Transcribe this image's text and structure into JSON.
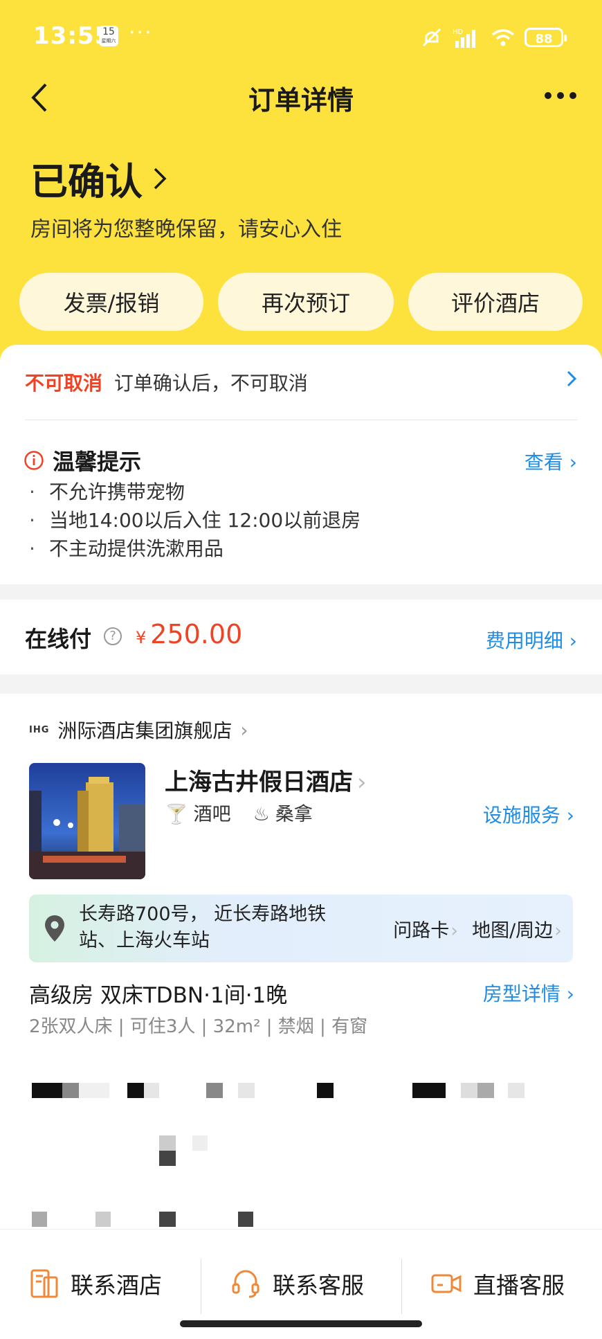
{
  "status_bar": {
    "time": "13:55",
    "calendar_day": "15",
    "calendar_sub": "星期六",
    "network": "HD",
    "battery": "88"
  },
  "nav": {
    "title": "订单详情"
  },
  "hero": {
    "status": "已确认",
    "subtitle": "房间将为您整晚保留，请安心入住"
  },
  "actions": [
    "发票/报销",
    "再次预订",
    "评价酒店"
  ],
  "cancel": {
    "tag": "不可取消",
    "text": "订单确认后，不可取消"
  },
  "tips": {
    "title": "温馨提示",
    "view_label": "查看",
    "items": [
      "不允许携带宠物",
      "当地14:00以后入住 12:00以前退房",
      "不主动提供洗漱用品"
    ]
  },
  "payment": {
    "label": "在线付",
    "currency": "¥",
    "amount": "250.00",
    "fee_link": "费用明细"
  },
  "hotel": {
    "brand_logo": "IHG",
    "brand_store": "洲际酒店集团旗舰店",
    "name": "上海古井假日酒店",
    "amenities": [
      "酒吧",
      "桑拿"
    ],
    "facility_link": "设施服务",
    "address": "长寿路700号， 近长寿路地铁站、上海火车站",
    "address_actions": [
      "问路卡",
      "地图/周边"
    ]
  },
  "room": {
    "title": "高级房 双床TDBN·1间·1晚",
    "detail_link": "房型详情",
    "meta": "2张双人床 | 可住3人 | 32m² | 禁烟 | 有窗"
  },
  "bottom_bar": [
    "联系酒店",
    "联系客服",
    "直播客服"
  ],
  "colors": {
    "brand_yellow": "#FDE23E",
    "accent_red": "#EE4324",
    "link_blue": "#1E8DE8"
  }
}
